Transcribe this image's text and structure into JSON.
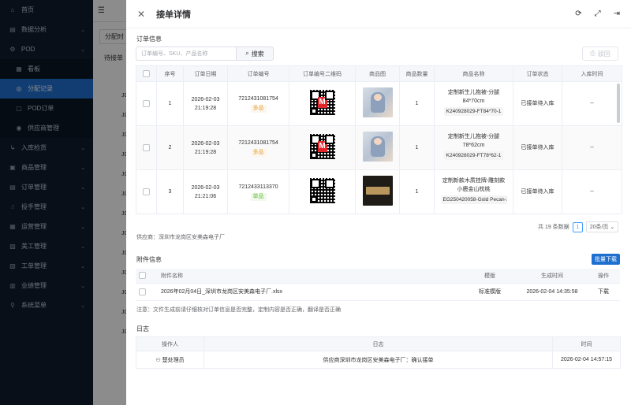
{
  "sidebar": {
    "items": [
      {
        "label": "首页",
        "icon": "home-icon",
        "glyph": "⌂",
        "chevron": false
      },
      {
        "label": "数据分析",
        "icon": "chart-icon",
        "glyph": "▤",
        "chevron": true
      },
      {
        "label": "POD",
        "icon": "pod-icon",
        "glyph": "⚙",
        "chevron": true,
        "expanded": true
      },
      {
        "label": "看板",
        "icon": "dashboard-icon",
        "glyph": "▦",
        "sub": true
      },
      {
        "label": "分配记录",
        "icon": "record-icon",
        "glyph": "◎",
        "sub": true,
        "active": true
      },
      {
        "label": "POD订单",
        "icon": "order-icon",
        "glyph": "▢",
        "sub": true
      },
      {
        "label": "供应商管理",
        "icon": "supplier-icon",
        "glyph": "◉",
        "sub": true
      },
      {
        "label": "入库检货",
        "icon": "inbound-icon",
        "glyph": "↳",
        "chevron": true
      },
      {
        "label": "商品管理",
        "icon": "goods-icon",
        "glyph": "▣",
        "chevron": true
      },
      {
        "label": "订单管理",
        "icon": "orders-icon",
        "glyph": "▤",
        "chevron": true
      },
      {
        "label": "投手管理",
        "icon": "pitcher-icon",
        "glyph": "☝",
        "chevron": true
      },
      {
        "label": "运营管理",
        "icon": "ops-icon",
        "glyph": "▦",
        "chevron": true
      },
      {
        "label": "美工管理",
        "icon": "design-icon",
        "glyph": "▨",
        "chevron": true
      },
      {
        "label": "工单管理",
        "icon": "ticket-icon",
        "glyph": "▧",
        "chevron": true
      },
      {
        "label": "业绩管理",
        "icon": "perf-icon",
        "glyph": "▥",
        "chevron": true
      },
      {
        "label": "系统菜单",
        "icon": "system-icon",
        "glyph": "⚲",
        "chevron": true
      }
    ]
  },
  "background": {
    "tab": "分配时",
    "subtab": "待接单",
    "row_labels": [
      "JC",
      "JC",
      "JC",
      "JC",
      "JC",
      "JC",
      "JC",
      "JC",
      "JC",
      "JC",
      "JC",
      "JC",
      "JC"
    ]
  },
  "drawer": {
    "title": "接单详情",
    "order_section": "订单信息",
    "search_placeholder": "订单编号、SKU、产品名称",
    "search_label": "搜索",
    "reject_label": "驳回",
    "columns": [
      "序号",
      "订单日期",
      "订单编号",
      "订单编号二维码",
      "商品图",
      "商品数量",
      "商品名称",
      "订单状态",
      "入库时间"
    ],
    "rows": [
      {
        "index": "1",
        "date": "2026-02-03",
        "time": "21:19:28",
        "order_no": "7212431081754",
        "tag": "多品",
        "tag_type": "orange",
        "qty": "1",
        "name1": "定制新生儿抱被-分腿",
        "name2": "84*70cm",
        "sku": "K240928029-FT84*70-1",
        "status": "已接单待入库",
        "inbound": "--",
        "img": "doll",
        "qr_m": true
      },
      {
        "index": "2",
        "date": "2026-02-03",
        "time": "21:19:28",
        "order_no": "7212431081754",
        "tag": "多品",
        "tag_type": "orange",
        "qty": "1",
        "name1": "定制新生儿抱被-分腿",
        "name2": "78*62cm",
        "sku": "K240928029-FT78*62-1",
        "status": "已接单待入库",
        "inbound": "--",
        "img": "doll",
        "qr_m": true
      },
      {
        "index": "3",
        "date": "2026-02-03",
        "time": "21:21:06",
        "order_no": "7212433113370",
        "tag": "单品",
        "tag_type": "green",
        "qty": "1",
        "name1": "定制新款木质挂牌-雕刻款",
        "name2": "小鹿金山枕桃",
        "sku": "EG250420058-Gold Pecan-1",
        "status": "已接单待入库",
        "inbound": "--",
        "img": "wood",
        "qr_m": false
      }
    ],
    "pagination": {
      "total": "共 19 条数据",
      "page": "1",
      "size": "20条/页"
    },
    "supplier": "供应商：深圳市龙岗区安美森电子厂",
    "attach_section": "附件信息",
    "batch_download": "批量下载",
    "file_columns": [
      "附件名称",
      "模版",
      "生成时间",
      "操作"
    ],
    "files": [
      {
        "name": "2026年02月04日_深圳市龙岗区安美森电子厂.xlsx",
        "template": "标准模版",
        "time": "2026-02-04 14:35:58",
        "action": "下载"
      }
    ],
    "note": "注意：文件生成前请仔细核对订单信息是否完整，定制内容是否正确，翻译是否正确",
    "log_section": "日志",
    "log_columns": [
      "操作人",
      "日志",
      "时间"
    ],
    "logs": [
      {
        "operator": "楚处理员",
        "log": "供应商深圳市龙岗区安美森电子厂：确认接单",
        "time": "2026-02-04 14:57:15"
      }
    ]
  }
}
